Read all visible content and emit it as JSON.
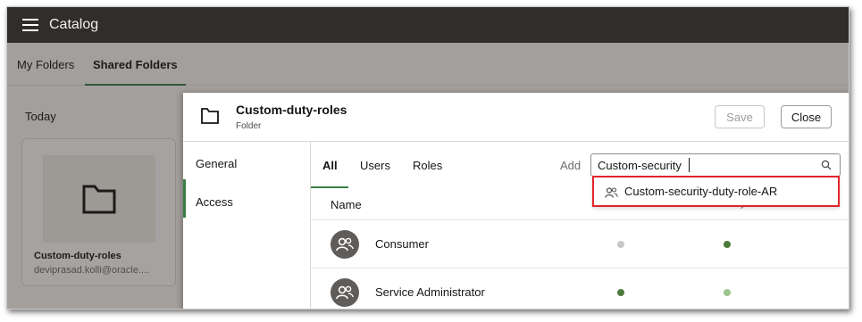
{
  "app": {
    "title": "Catalog"
  },
  "folder_tabs": [
    {
      "label": "My Folders"
    },
    {
      "label": "Shared Folders",
      "active": true
    }
  ],
  "section": {
    "label": "Today"
  },
  "card": {
    "title": "Custom-duty-roles",
    "subtitle": "deviprasad.kolli@oracle...."
  },
  "dialog": {
    "title": "Custom-duty-roles",
    "subtitle": "Folder",
    "save_label": "Save",
    "close_label": "Close",
    "nav": [
      {
        "label": "General"
      },
      {
        "label": "Access",
        "active": true
      }
    ],
    "tabs": [
      {
        "label": "All",
        "active": true
      },
      {
        "label": "Users"
      },
      {
        "label": "Roles"
      }
    ],
    "add_label": "Add",
    "search_value": "Custom-security",
    "columns": {
      "name": "Name",
      "read_write": "Read-Write",
      "read_only": "Read-Only"
    },
    "rows": [
      {
        "name": "Consumer",
        "read_write": false,
        "read_only": true
      },
      {
        "name": "Service Administrator",
        "read_write": true,
        "read_only": false
      }
    ],
    "suggestion": {
      "label": "Custom-security-duty-role-AR"
    }
  },
  "colors": {
    "accent": "#3a7d44",
    "dot_on": "#4d7a3a",
    "dot_off": "#c9c7c5",
    "dot_light": "#9cc48e",
    "highlight_border": "#e2242b"
  }
}
